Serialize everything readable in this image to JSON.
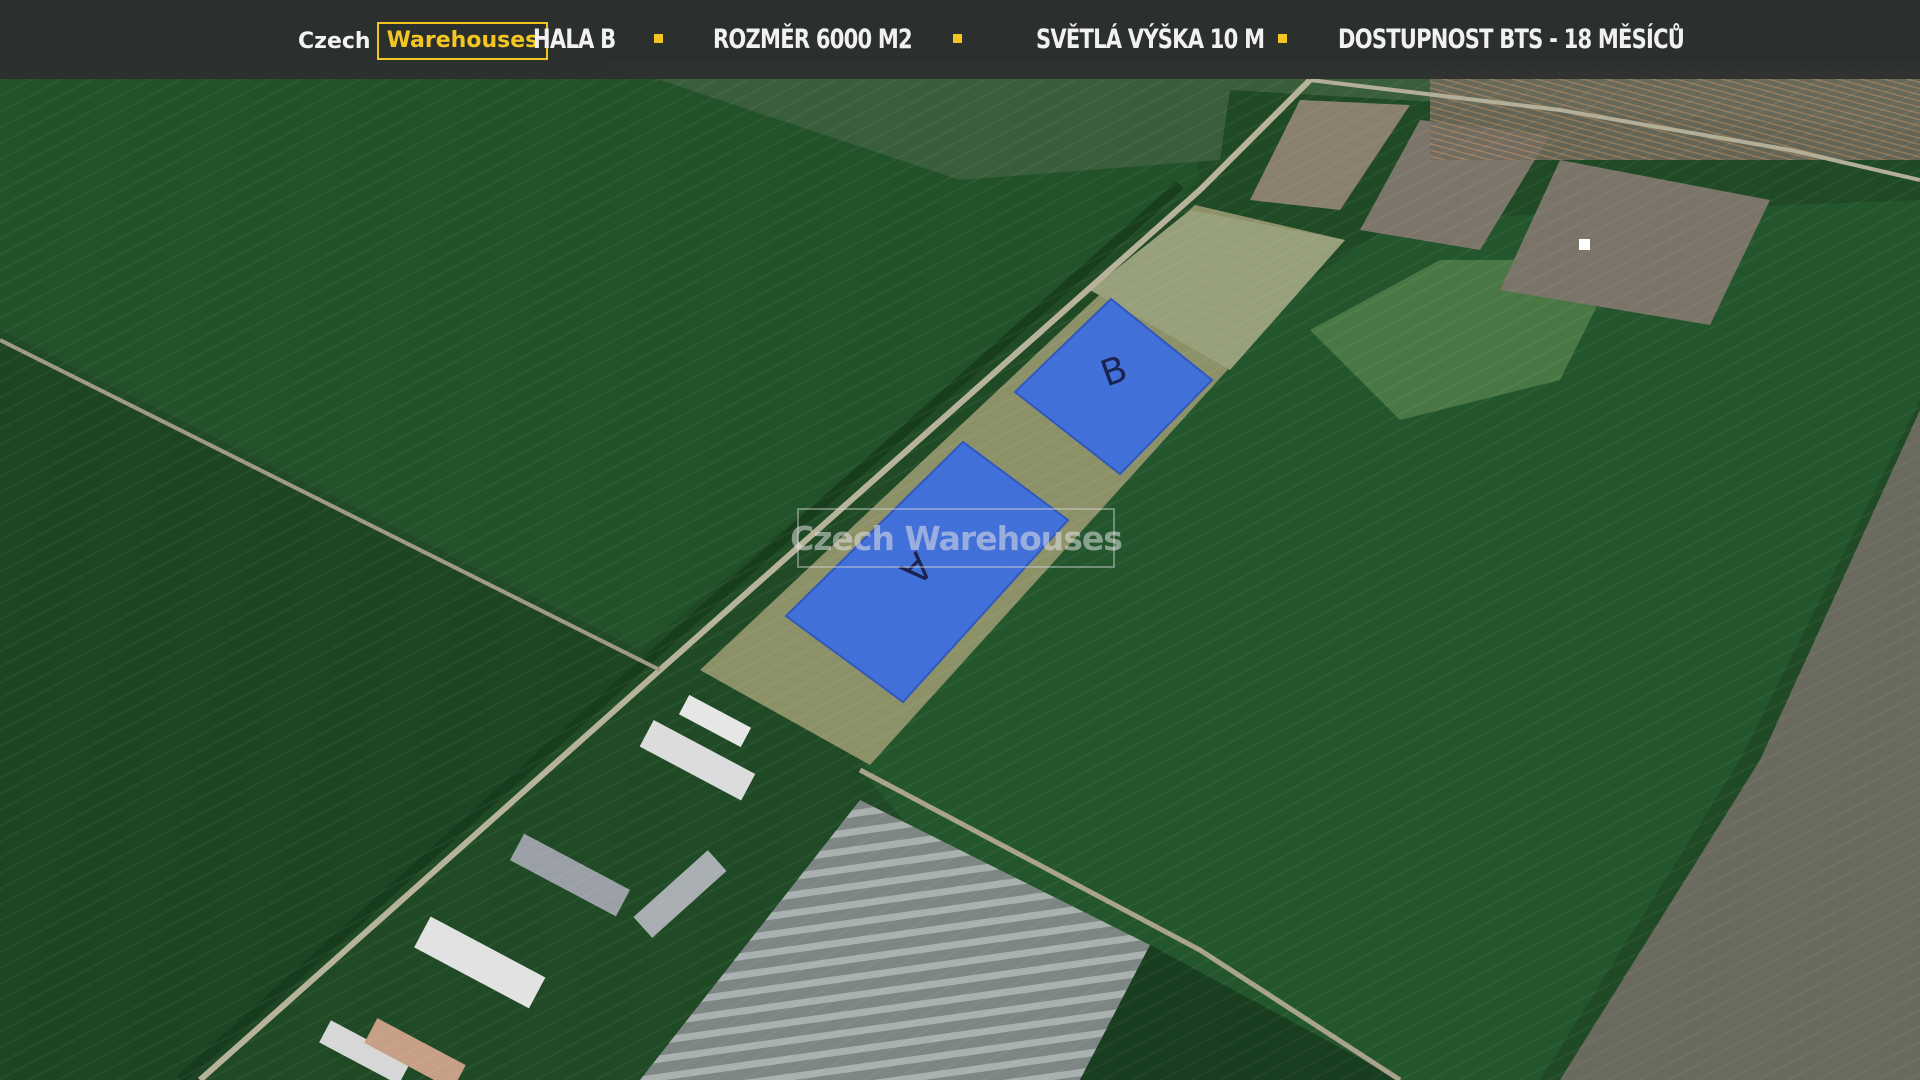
{
  "header": {
    "logo": {
      "part1": "Czech",
      "part2": "Warehouses"
    },
    "items": [
      "HALA B",
      "ROZMĚR 6000 M2",
      "SVĚTLÁ VÝŠKA  10 M",
      "DOSTUPNOST BTS - 18 MĚSÍCŮ"
    ]
  },
  "map": {
    "plots": [
      {
        "label": "A"
      },
      {
        "label": "B"
      }
    ],
    "watermark": "Czech Warehouses"
  },
  "colors": {
    "accent": "#f3c623",
    "plot_fill": "#3f6fe0",
    "header_bg": "#2c2e2e",
    "field_dark": "#1f4a25",
    "field_mid": "#2e6434"
  }
}
